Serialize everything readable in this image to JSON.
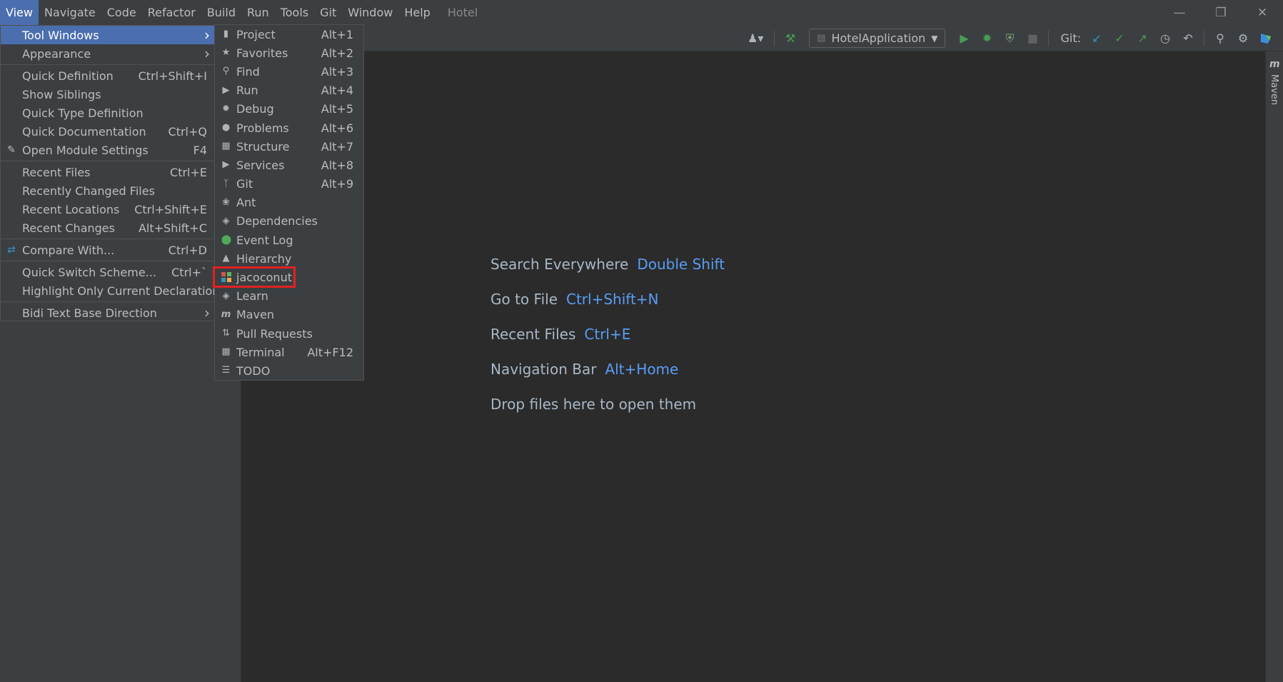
{
  "menubar": {
    "items": [
      {
        "name": "view",
        "label": "View",
        "active": true
      },
      {
        "name": "navigate",
        "label": "Navigate"
      },
      {
        "name": "code",
        "label": "Code"
      },
      {
        "name": "refactor",
        "label": "Refactor"
      },
      {
        "name": "build",
        "label": "Build"
      },
      {
        "name": "run",
        "label": "Run"
      },
      {
        "name": "tools",
        "label": "Tools"
      },
      {
        "name": "git",
        "label": "Git"
      },
      {
        "name": "window",
        "label": "Window"
      },
      {
        "name": "help",
        "label": "Help"
      }
    ],
    "project_name": "Hotel"
  },
  "toolbar": {
    "run_config": "HotelApplication",
    "git_label": "Git:"
  },
  "view_menu": {
    "items": [
      {
        "label": "Tool Windows",
        "shortcut": "",
        "submenu": true,
        "highlighted": true
      },
      {
        "label": "Appearance",
        "shortcut": "",
        "submenu": true
      },
      {
        "sep": true
      },
      {
        "label": "Quick Definition",
        "shortcut": "Ctrl+Shift+I"
      },
      {
        "label": "Show Siblings",
        "shortcut": ""
      },
      {
        "label": "Quick Type Definition",
        "shortcut": ""
      },
      {
        "label": "Quick Documentation",
        "shortcut": "Ctrl+Q"
      },
      {
        "label": "Open Module Settings",
        "shortcut": "F4",
        "icon": "pencil-icon"
      },
      {
        "sep": true
      },
      {
        "label": "Recent Files",
        "shortcut": "Ctrl+E"
      },
      {
        "label": "Recently Changed Files",
        "shortcut": ""
      },
      {
        "label": "Recent Locations",
        "shortcut": "Ctrl+Shift+E"
      },
      {
        "label": "Recent Changes",
        "shortcut": "Alt+Shift+C"
      },
      {
        "sep": true
      },
      {
        "label": "Compare With...",
        "shortcut": "Ctrl+D",
        "icon": "compare-icon"
      },
      {
        "sep": true
      },
      {
        "label": "Quick Switch Scheme...",
        "shortcut": "Ctrl+`"
      },
      {
        "label": "Highlight Only Current Declaration",
        "shortcut": ""
      },
      {
        "sep": true
      },
      {
        "label": "Bidi Text Base Direction",
        "shortcut": "",
        "submenu": true
      }
    ]
  },
  "tool_windows_menu": {
    "items": [
      {
        "label": "Project",
        "shortcut": "Alt+1",
        "icon": "folder-icon"
      },
      {
        "label": "Favorites",
        "shortcut": "Alt+2",
        "icon": "star-icon"
      },
      {
        "label": "Find",
        "shortcut": "Alt+3",
        "icon": "search-icon"
      },
      {
        "label": "Run",
        "shortcut": "Alt+4",
        "icon": "run-icon"
      },
      {
        "label": "Debug",
        "shortcut": "Alt+5",
        "icon": "bug-icon"
      },
      {
        "label": "Problems",
        "shortcut": "Alt+6",
        "icon": "problems-icon"
      },
      {
        "label": "Structure",
        "shortcut": "Alt+7",
        "icon": "structure-icon"
      },
      {
        "label": "Services",
        "shortcut": "Alt+8",
        "icon": "services-icon"
      },
      {
        "label": "Git",
        "shortcut": "Alt+9",
        "icon": "git-branch-icon"
      },
      {
        "label": "Ant",
        "shortcut": "",
        "icon": "ant-icon"
      },
      {
        "label": "Dependencies",
        "shortcut": "",
        "icon": "layers-icon"
      },
      {
        "label": "Event Log",
        "shortcut": "",
        "icon": "event-log-icon"
      },
      {
        "label": "Hierarchy",
        "shortcut": "",
        "icon": "hierarchy-icon"
      },
      {
        "label": "jacoconut",
        "shortcut": "",
        "icon": "jacoconut-icon",
        "highlighted_box": true
      },
      {
        "label": "Learn",
        "shortcut": "",
        "icon": "learn-icon"
      },
      {
        "label": "Maven",
        "shortcut": "",
        "icon": "maven-icon"
      },
      {
        "label": "Pull Requests",
        "shortcut": "",
        "icon": "pull-request-icon"
      },
      {
        "label": "Terminal",
        "shortcut": "Alt+F12",
        "icon": "terminal-icon"
      },
      {
        "label": "TODO",
        "shortcut": "",
        "icon": "list-icon"
      }
    ]
  },
  "editor_hints": [
    {
      "text": "Search Everywhere",
      "key": "Double Shift"
    },
    {
      "text": "Go to File",
      "key": "Ctrl+Shift+N"
    },
    {
      "text": "Recent Files",
      "key": "Ctrl+E"
    },
    {
      "text": "Navigation Bar",
      "key": "Alt+Home"
    },
    {
      "text": "Drop files here to open them",
      "key": ""
    }
  ],
  "right_stripe": {
    "label": "Maven"
  },
  "colors": {
    "accent": "#4b6eaf",
    "link": "#589df6",
    "highlight_box": "#e32121",
    "run_green": "#499c54"
  }
}
